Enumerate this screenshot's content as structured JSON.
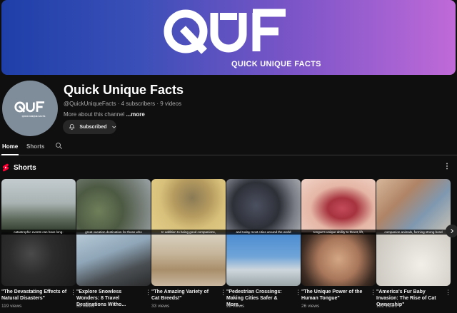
{
  "banner": {
    "logo_text": "QUF",
    "tagline": "QUICK UNIQUE FACTS"
  },
  "channel": {
    "avatar_logo": "QUF",
    "avatar_tagline": "QUICK UNIQUE FACTS",
    "name": "Quick Unique Facts",
    "meta": "@QuickUniqueFacts · 4 subscribers · 9 videos",
    "about": "More about this channel ",
    "about_more": "...more",
    "subscribe_label": "Subscribed",
    "subscribe_icon": "bell-icon"
  },
  "tabs": [
    {
      "label": "Home",
      "active": true
    },
    {
      "label": "Shorts",
      "active": false
    }
  ],
  "shorts": {
    "title": "Shorts",
    "icon": "shorts-icon",
    "items": [
      {
        "title": "\"The Devastating Effects of Natural Disasters\"",
        "views": "119 views",
        "caption": "catastrophic events can have long-"
      },
      {
        "title": "\"Explore Snowless Wonders: 8 Travel Destinations Witho...",
        "views": "39 views",
        "caption": "great vacation destination for those who"
      },
      {
        "title": "\"The Amazing Variety of Cat Breeds!\"",
        "views": "33 views",
        "caption": "In addition to being good companions,"
      },
      {
        "title": "\"Pedestrian Crossings: Making Cities Safer & More...",
        "views": "28 views",
        "caption": "and today most cities around the world"
      },
      {
        "title": "\"The Unique Power of the Human Tongue\"",
        "views": "26 views",
        "caption": "tongue's unique ability to thrust, lift,"
      },
      {
        "title": "\"America's Fur Baby Invasion: The Rise of Cat Ownership\"",
        "views": "162 views",
        "caption": "companion animals, forming strong bond"
      }
    ]
  },
  "colors": {
    "background": "#0f0f0f",
    "banner_start": "#1f3fa8",
    "banner_end": "#c06ad8",
    "avatar_bg": "#7f8d9b",
    "shorts_red": "#ff0033"
  }
}
